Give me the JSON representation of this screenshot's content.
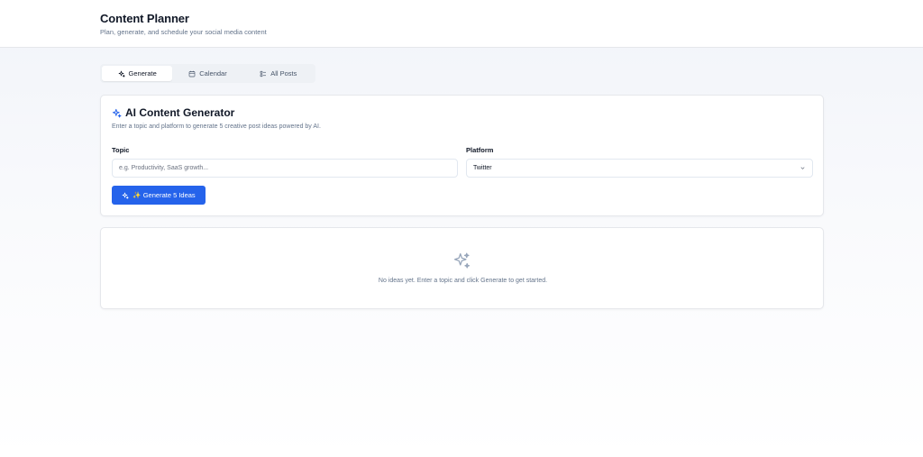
{
  "header": {
    "title": "Content Planner",
    "subtitle": "Plan, generate, and schedule your social media content"
  },
  "tabs": [
    {
      "label": "Generate",
      "icon": "sparkles-icon",
      "active": true
    },
    {
      "label": "Calendar",
      "icon": "calendar-icon",
      "active": false
    },
    {
      "label": "All Posts",
      "icon": "list-icon",
      "active": false
    }
  ],
  "generator": {
    "title": "AI Content Generator",
    "description": "Enter a topic and platform to generate 5 creative post ideas powered by AI.",
    "topic_label": "Topic",
    "topic_placeholder": "e.g. Productivity, SaaS growth...",
    "platform_label": "Platform",
    "platform_value": "Twitter",
    "generate_button": "✨ Generate 5 Ideas"
  },
  "empty_state": {
    "message": "No ideas yet. Enter a topic and click Generate to get started."
  },
  "colors": {
    "accent": "#2563eb",
    "sparkle": "#2563eb",
    "muted": "#94a3b8"
  }
}
